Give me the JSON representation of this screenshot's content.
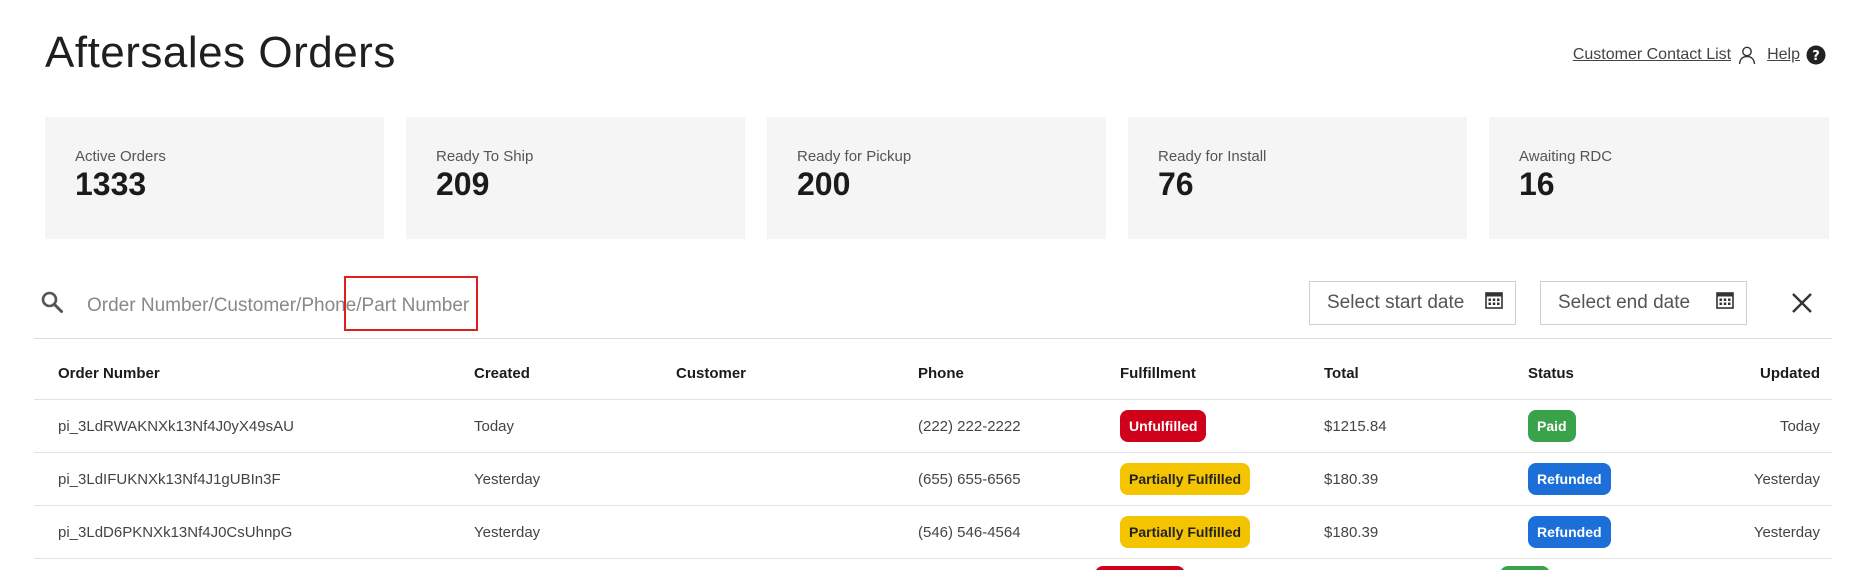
{
  "header": {
    "title": "Aftersales Orders",
    "contact_link": "Customer Contact List",
    "help_link": "Help"
  },
  "stats": [
    {
      "label": "Active Orders",
      "value": "1333"
    },
    {
      "label": "Ready To Ship",
      "value": "209"
    },
    {
      "label": "Ready for Pickup",
      "value": "200"
    },
    {
      "label": "Ready for Install",
      "value": "76"
    },
    {
      "label": "Awaiting RDC",
      "value": "16"
    }
  ],
  "search": {
    "placeholder": "Order Number/Customer/Phone/Part Number",
    "value": ""
  },
  "date_filters": {
    "start_placeholder": "Select start date",
    "end_placeholder": "Select end date"
  },
  "table": {
    "headers": {
      "order_number": "Order Number",
      "created": "Created",
      "customer": "Customer",
      "phone": "Phone",
      "fulfillment": "Fulfillment",
      "total": "Total",
      "status": "Status",
      "updated": "Updated"
    },
    "rows": [
      {
        "order_number": "pi_3LdRWAKNXk13Nf4J0yX49sAU",
        "created": "Today",
        "customer": "",
        "phone": "(222) 222-2222",
        "fulfillment": "Unfulfilled",
        "total": "$1215.84",
        "status": "Paid",
        "updated": "Today"
      },
      {
        "order_number": "pi_3LdIFUKNXk13Nf4J1gUBIn3F",
        "created": "Yesterday",
        "customer": "",
        "phone": "(655) 655-6565",
        "fulfillment": "Partially Fulfilled",
        "total": "$180.39",
        "status": "Refunded",
        "updated": "Yesterday"
      },
      {
        "order_number": "pi_3LdD6PKNXk13Nf4J0CsUhnpG",
        "created": "Yesterday",
        "customer": "",
        "phone": "(546) 546-4564",
        "fulfillment": "Partially Fulfilled",
        "total": "$180.39",
        "status": "Refunded",
        "updated": "Yesterday"
      }
    ]
  },
  "colors": {
    "unfulfilled": "#d0021b",
    "partially_fulfilled": "#f5c400",
    "paid": "#3aa24a",
    "refunded": "#1c6fd8",
    "highlight": "#e02020"
  },
  "icons": {
    "search": "search-icon",
    "user": "user-icon",
    "help": "help-icon",
    "calendar": "calendar-icon",
    "close": "close-icon"
  }
}
